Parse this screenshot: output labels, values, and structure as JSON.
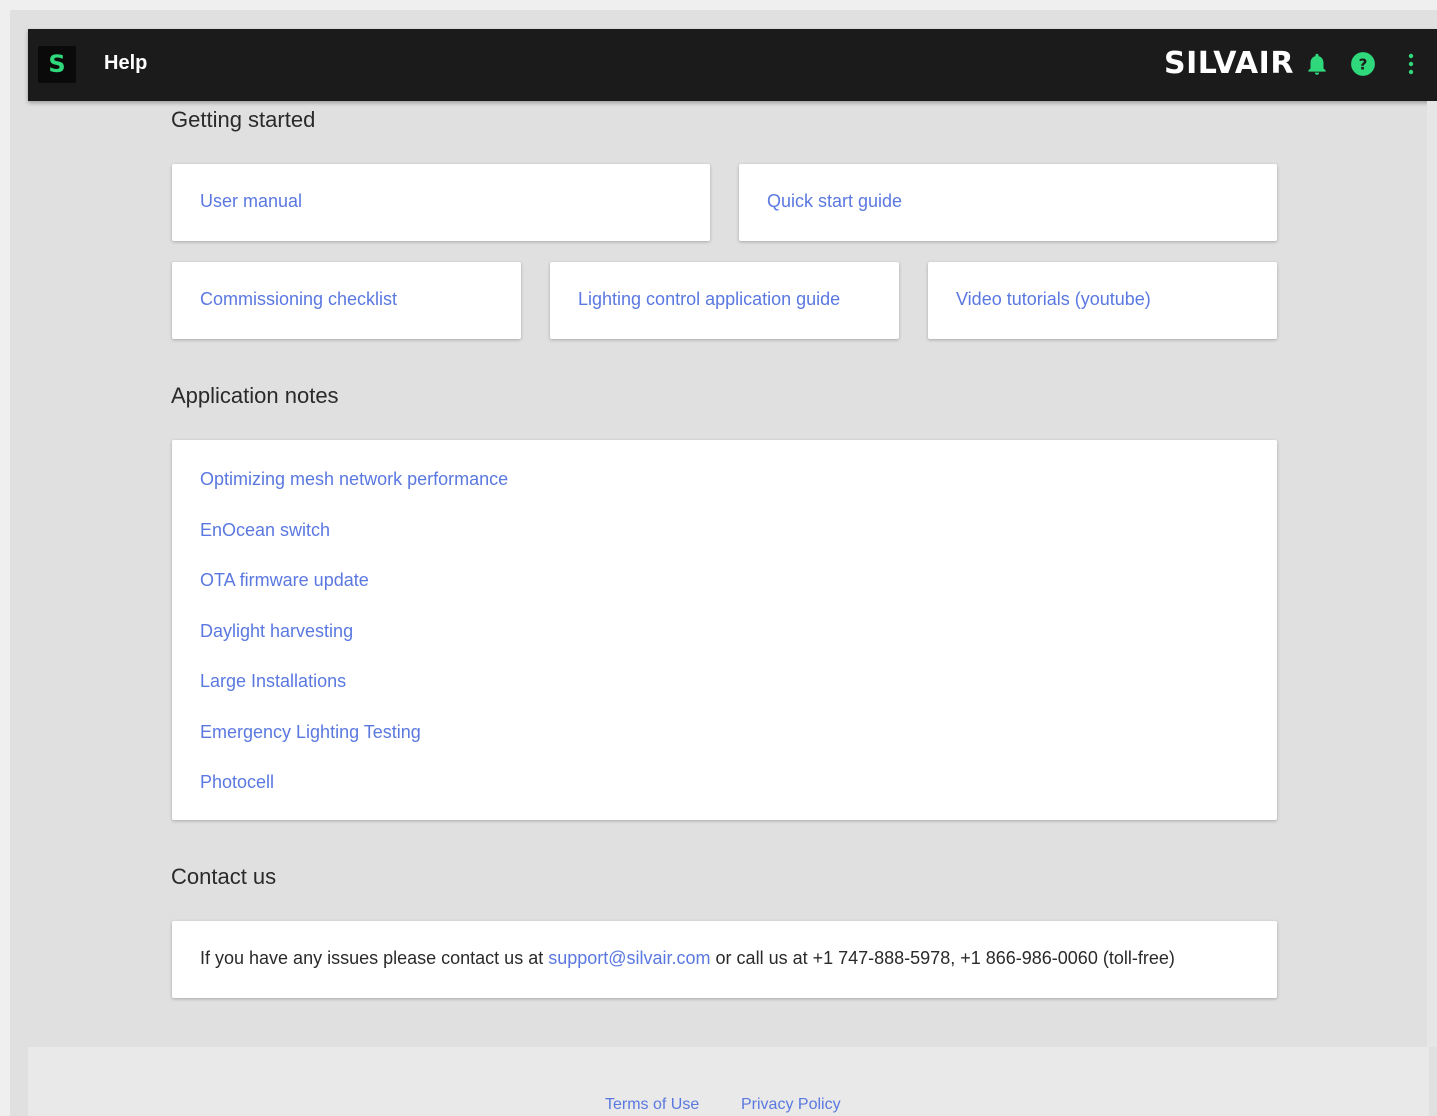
{
  "app": {
    "logo_letter": "S",
    "title": "Help",
    "brand": "SILVAIR",
    "accent_color": "#2fd87a",
    "link_color": "#5a78e0",
    "icons": [
      "bell-icon",
      "help-circle-icon",
      "more-vert-icon"
    ]
  },
  "getting_started": {
    "title": "Getting started",
    "links": [
      "User manual",
      "Quick start guide",
      "Commissioning checklist",
      "Lighting control application guide",
      "Video tutorials (youtube)"
    ]
  },
  "application_notes": {
    "title": "Application notes",
    "links": [
      "Optimizing mesh network performance",
      "EnOcean switch",
      "OTA firmware update",
      "Daylight harvesting",
      "Large Installations",
      "Emergency Lighting Testing",
      "Photocell"
    ]
  },
  "contact": {
    "title": "Contact us",
    "text_before": "If you have any issues please contact us at ",
    "email": "support@silvair.com",
    "text_after": " or call us at +1 747-888-5978, +1 866-986-0060 (toll-free)"
  },
  "footer": {
    "terms": "Terms of Use",
    "privacy": "Privacy Policy"
  }
}
